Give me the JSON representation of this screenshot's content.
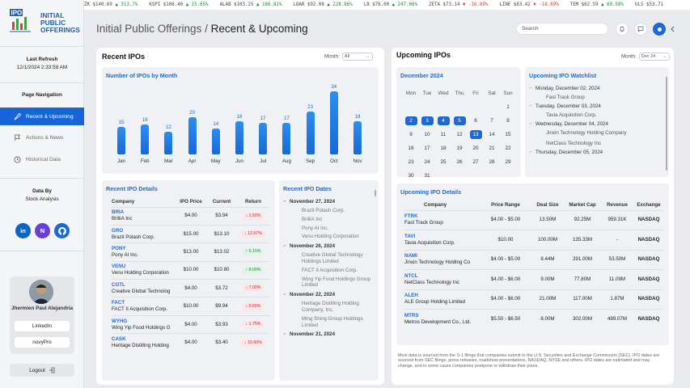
{
  "ticker": [
    {
      "sym": "ZK",
      "text": "$140.69",
      "chg": "313.7%",
      "dir": "up"
    },
    {
      "sym": "KSPI",
      "text": "$106.40",
      "chg": "15.65%",
      "dir": "up"
    },
    {
      "sym": "ALAB",
      "text": "$103.25",
      "chg": "186.81%",
      "dir": "up"
    },
    {
      "sym": "LOAR",
      "text": "$92.08",
      "chg": "228.86%",
      "dir": "up"
    },
    {
      "sym": "LB",
      "text": "$76.00",
      "chg": "247.06%",
      "dir": "up"
    },
    {
      "sym": "ZETA",
      "text": "$73.14",
      "chg": "-16.89%",
      "dir": "dn"
    },
    {
      "sym": "LINE",
      "text": "$63.42",
      "chg": "-18.69%",
      "dir": "dn"
    },
    {
      "sym": "TEM",
      "text": "$62.59",
      "chg": "69.58%",
      "dir": "up"
    },
    {
      "sym": "ULS",
      "text": "$53.71",
      "chg": "",
      "dir": "up"
    }
  ],
  "logo": {
    "line1": "INITIAL",
    "line2": "PUBLIC",
    "line3": "OFFERINGS",
    "mark": "IPO"
  },
  "sidebar": {
    "refresh_label": "Last Refresh",
    "refresh_value": "12/1/2024 2:33:58 AM",
    "nav_title": "Page Navigation",
    "nav": [
      {
        "label": "Recent & Upcoming",
        "icon": "rocket-icon"
      },
      {
        "label": "Actions & News",
        "icon": "flag-icon"
      },
      {
        "label": "Historical Data",
        "icon": "history-icon"
      }
    ],
    "data_by": "Data By",
    "data_source": "Stock Analysis",
    "profile_name": "Jhermien Paul Alejandria",
    "linkedin": "LinkedIn",
    "novypro": "novyPro",
    "logout": "Logout"
  },
  "header": {
    "title_prefix": "Initial Public Offerings / ",
    "title_main": "Recent & Upcoming",
    "search_placeholder": "Search"
  },
  "recent": {
    "title": "Recent IPOs",
    "month_label": "Month:",
    "month_value": "All",
    "chart_title": "Number of IPOs by Month",
    "details_title": "Recent IPO Details",
    "cols": [
      "Company",
      "IPO Price",
      "Current",
      "Return"
    ],
    "rows": [
      {
        "tk": "BRIA",
        "name": "BrilliA Inc",
        "price": "$4.00",
        "cur": "$3.94",
        "ret": "1.50%",
        "dir": "dn"
      },
      {
        "tk": "GRO",
        "name": "Brazil Potash Corp.",
        "price": "$15.00",
        "cur": "$13.10",
        "ret": "12.67%",
        "dir": "dn"
      },
      {
        "tk": "PONY",
        "name": "Pony AI Inc.",
        "price": "$13.00",
        "cur": "$13.02",
        "ret": "0.15%",
        "dir": "up"
      },
      {
        "tk": "VENU",
        "name": "Venu Holding Corporation",
        "price": "$10.00",
        "cur": "$10.80",
        "ret": "8.00%",
        "dir": "up"
      },
      {
        "tk": "CGTL",
        "name": "Creative Global Technolog",
        "price": "$4.00",
        "cur": "$3.72",
        "ret": "7.00%",
        "dir": "dn"
      },
      {
        "tk": "FACT",
        "name": "FACT II Acquisition Corp.",
        "price": "$10.00",
        "cur": "$9.94",
        "ret": "0.60%",
        "dir": "dn"
      },
      {
        "tk": "WYHG",
        "name": "Wing Yip Food Holdings G",
        "price": "$4.00",
        "cur": "$3.93",
        "ret": "1.75%",
        "dir": "dn"
      },
      {
        "tk": "CASK",
        "name": "Heritage Distilling Holding",
        "price": "$4.00",
        "cur": "$3.40",
        "ret": "15.00%",
        "dir": "dn"
      }
    ],
    "dates_title": "Recent IPO Dates",
    "dates": [
      {
        "date": "November 27, 2024",
        "items": [
          "Brazil Potash Corp.",
          "BrilliA Inc",
          "Pony AI Inc.",
          "Venu Holding Corporation"
        ]
      },
      {
        "date": "November 26, 2024",
        "items": [
          "Creative Global Technology Holdings Limited",
          "FACT II Acquisition Corp.",
          "Wing Yip Food Holdings Group Limited"
        ]
      },
      {
        "date": "November 22, 2024",
        "items": [
          "Heritage Distilling Holding Company, Inc.",
          "Ming Shing Group Holdings Limited"
        ]
      },
      {
        "date": "November 21, 2024",
        "items": []
      }
    ]
  },
  "chart_data": {
    "type": "bar",
    "title": "Number of IPOs by Month",
    "categories": [
      "Jan",
      "Feb",
      "Mar",
      "Apr",
      "May",
      "Jun",
      "Jul",
      "Aug",
      "Sep",
      "Oct",
      "Nov"
    ],
    "values": [
      15,
      16,
      12,
      20,
      14,
      18,
      17,
      17,
      23,
      34,
      18
    ],
    "ylim": [
      0,
      34
    ]
  },
  "upcoming": {
    "title": "Upcoming IPOs",
    "month_label": "Month:",
    "month_value": "Dec 24",
    "cal_title": "December 2024",
    "weekdays": [
      "Mon",
      "Tue",
      "Wed",
      "Thu",
      "Fri",
      "Sat",
      "Sun"
    ],
    "weeks": [
      [
        "",
        "",
        "",
        "",
        "",
        "",
        "1"
      ],
      [
        "2",
        "3",
        "4",
        "5",
        "6",
        "7",
        "8"
      ],
      [
        "9",
        "10",
        "11",
        "12",
        "13",
        "14",
        "15"
      ],
      [
        "16",
        "17",
        "18",
        "19",
        "20",
        "21",
        "22"
      ],
      [
        "23",
        "24",
        "25",
        "26",
        "27",
        "28",
        "29"
      ],
      [
        "30",
        "31",
        "",
        "",
        "",
        "",
        ""
      ]
    ],
    "highlight": [
      "2",
      "3",
      "4",
      "5",
      "13"
    ],
    "watch_title": "Upcoming IPO Watchlist",
    "watch": [
      {
        "date": "Monday, December 02, 2024",
        "items": [
          "Fast Track Group"
        ]
      },
      {
        "date": "Tuesday, December 03, 2024",
        "items": [
          "Tavia Acquisition Corp."
        ]
      },
      {
        "date": "Wednesday, December 04, 2024",
        "items": [
          "Jinxin Technology Holding Company",
          "NetClass Technology Inc"
        ]
      },
      {
        "date": "Thursday, December 05, 2024",
        "items": []
      }
    ],
    "details_title": "Upcoming IPO Details",
    "cols": [
      "Company",
      "Price Range",
      "Deal Size",
      "Market Cap",
      "Revenue",
      "Exchange"
    ],
    "rows": [
      {
        "tk": "FTRK",
        "name": "Fast Track Group",
        "range": "$4.00 - $5.00",
        "deal": "13.50M",
        "cap": "92.25M",
        "rev": "959.31K",
        "ex": "NASDAQ"
      },
      {
        "tk": "TAVI",
        "name": "Tavia Acquisition Corp.",
        "range": "$10.00",
        "deal": "100.00M",
        "cap": "135.33M",
        "rev": "-",
        "ex": "NASDAQ"
      },
      {
        "tk": "NAMI",
        "name": "Jinxin Technology Holding Co",
        "range": "$4.00 - $5.00",
        "deal": "8.44M",
        "cap": "291.00M",
        "rev": "53.50M",
        "ex": "NASDAQ"
      },
      {
        "tk": "NTCL",
        "name": "NetClass Technology Inc",
        "range": "$4.00 - $6.00",
        "deal": "9.00M",
        "cap": "77.80M",
        "rev": "11.09M",
        "ex": "NASDAQ"
      },
      {
        "tk": "ALEH",
        "name": "ALE Group Holding Limited",
        "range": "$4.00 - $6.00",
        "deal": "21.00M",
        "cap": "117.00M",
        "rev": "1.87M",
        "ex": "NASDAQ"
      },
      {
        "tk": "MTRS",
        "name": "Metros Development Co., Ltd.",
        "range": "$5.50 - $6.50",
        "deal": "8.00M",
        "cap": "302.00M",
        "rev": "489.07M",
        "ex": "NASDAQ"
      }
    ],
    "footnote": "Most data is sourced from the S-1 filings that companies submit to the U.S. Securities and Exchange Commission (SEC). IPO dates are sourced from SEC filings, press releases, roadshow presentations, NASDAQ, NYSE and others. IPO dates are estimated and may change, and in some cases companies postpone or withdraw their plans."
  },
  "colors": {
    "accent": "#1b6ad6",
    "down": "#dd1133",
    "up": "#1a8a3a"
  }
}
